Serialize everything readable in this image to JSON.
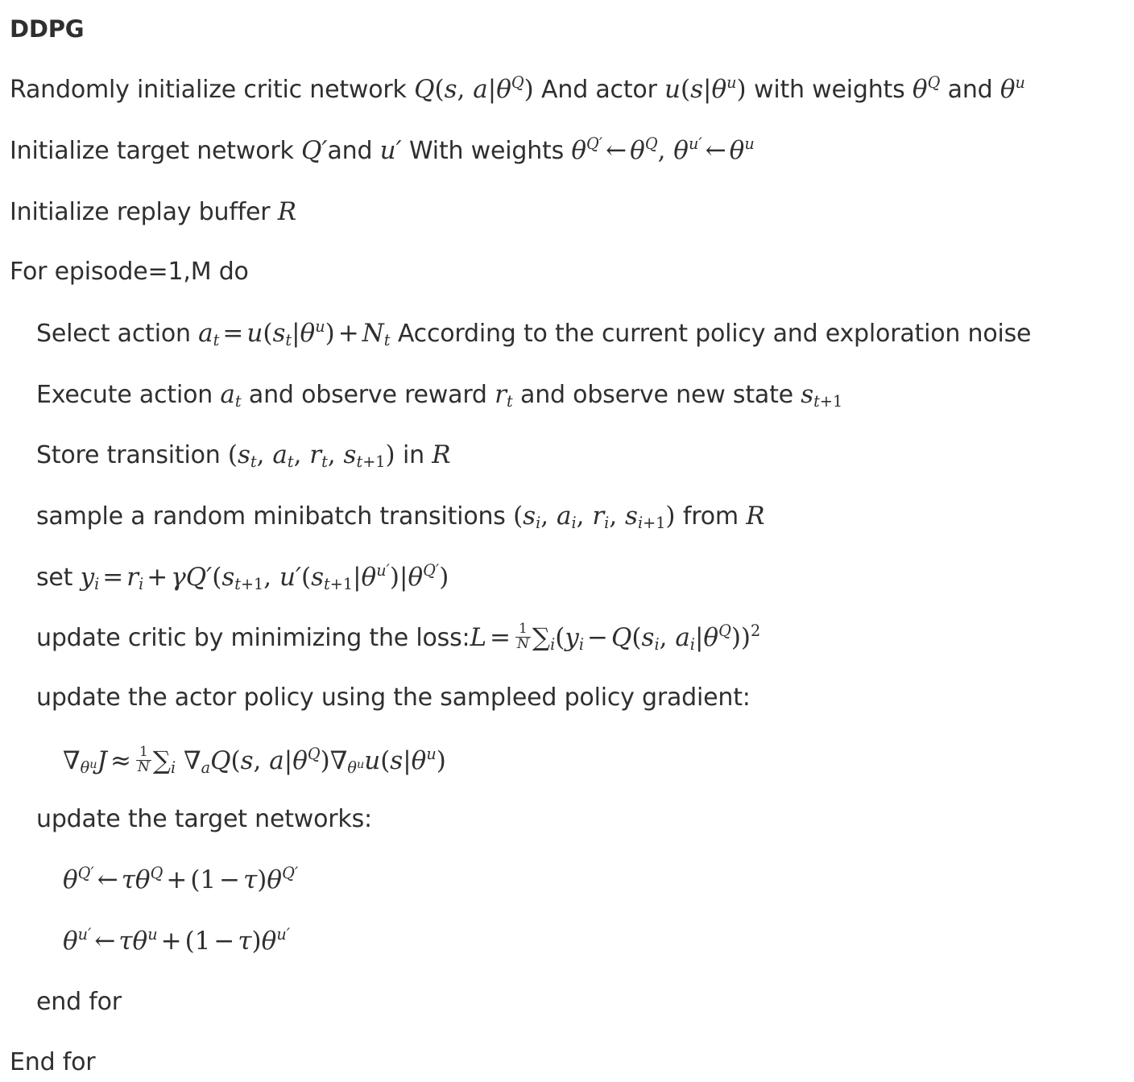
{
  "title": "DDPG",
  "lines": {
    "l1": {
      "t1": "Randomly initialize critic network ",
      "t2": " And actor ",
      "t3": " with weights ",
      "t4": " and "
    },
    "l2": {
      "t1": "Initialize target network ",
      "t2": "and ",
      "t3": " With weights "
    },
    "l3": {
      "t1": "Initialize replay buffer "
    },
    "l4": {
      "t1": "For episode=1,M do"
    },
    "l5": {
      "t1": "Select action ",
      "t2": " According to the current policy and exploration noise"
    },
    "l6": {
      "t1": "Execute action ",
      "t2": " and observe reward ",
      "t3": " and observe new state "
    },
    "l7": {
      "t1": "Store transition ",
      "t2": " in "
    },
    "l8": {
      "t1": "sample a random minibatch transitions ",
      "t2": " from "
    },
    "l9": {
      "t1": "set "
    },
    "l10": {
      "t1": "update critic by minimizing the loss:"
    },
    "l11": {
      "t1": "update the actor policy using the sampleed policy gradient:"
    },
    "l13": {
      "t1": "update the target networks:"
    },
    "l16": {
      "t1": "end for"
    },
    "l17": {
      "t1": "End for"
    }
  }
}
